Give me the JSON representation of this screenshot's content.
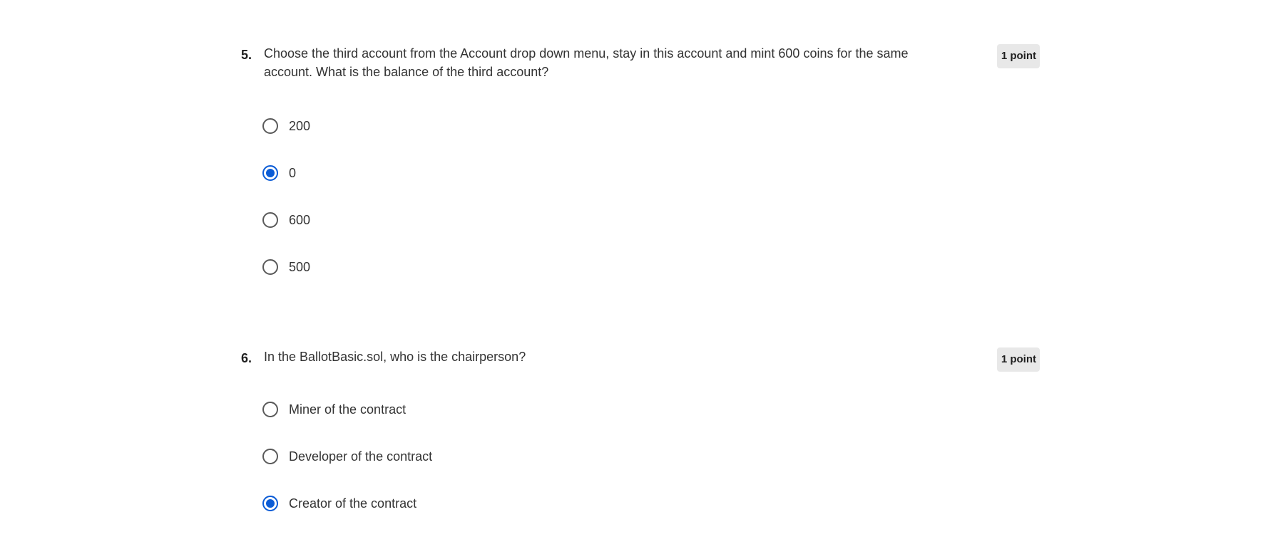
{
  "questions": [
    {
      "number": "5.",
      "text": "Choose the third account from the Account drop down menu, stay in this account and mint 600 coins for the same account. What is the balance of the third account?",
      "points": "1 point",
      "options": [
        {
          "label": "200",
          "selected": false
        },
        {
          "label": "0",
          "selected": true
        },
        {
          "label": "600",
          "selected": false
        },
        {
          "label": "500",
          "selected": false
        }
      ]
    },
    {
      "number": "6.",
      "text": "In the BallotBasic.sol, who is the chairperson?",
      "points": "1 point",
      "options": [
        {
          "label": "Miner of the contract",
          "selected": false
        },
        {
          "label": "Developer of the contract",
          "selected": false
        },
        {
          "label": "Creator of the contract",
          "selected": true
        }
      ]
    }
  ],
  "colors": {
    "selected_radio": "#0b5cd6",
    "unselected_radio": "#5a5a5a",
    "points_badge_bg": "#e8e8e8"
  }
}
